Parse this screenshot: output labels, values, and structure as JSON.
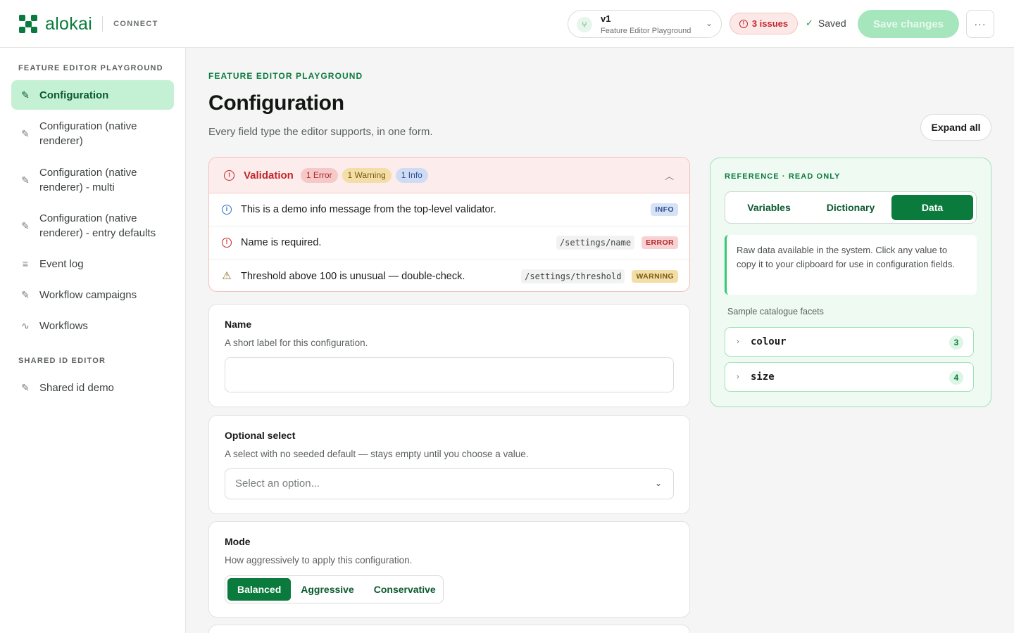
{
  "header": {
    "brand": "alokai",
    "brand_sub": "CONNECT",
    "version_title": "v1",
    "version_subtitle": "Feature Editor Playground",
    "issues": "3 issues",
    "saved": "Saved",
    "save_label": "Save changes",
    "more_label": "···"
  },
  "sidebar": {
    "section1": "FEATURE EDITOR PLAYGROUND",
    "items": [
      {
        "label": "Configuration",
        "icon": "edit-icon"
      },
      {
        "label": "Configuration (native renderer)",
        "icon": "edit-icon"
      },
      {
        "label": "Configuration (native renderer) - multi",
        "icon": "edit-icon"
      },
      {
        "label": "Configuration (native renderer) - entry defaults",
        "icon": "edit-icon"
      },
      {
        "label": "Event log",
        "icon": "list-icon"
      },
      {
        "label": "Workflow campaigns",
        "icon": "edit-icon"
      },
      {
        "label": "Workflows",
        "icon": "activity-icon"
      }
    ],
    "section2": "SHARED ID EDITOR",
    "items2": [
      {
        "label": "Shared id demo",
        "icon": "edit-icon"
      }
    ]
  },
  "main": {
    "eyebrow": "FEATURE EDITOR PLAYGROUND",
    "title": "Configuration",
    "subtitle": "Every field type the editor supports, in one form.",
    "expand_label": "Expand all"
  },
  "validation": {
    "title": "Validation",
    "badges": {
      "error": "1 Error",
      "warning": "1 Warning",
      "info": "1 Info"
    },
    "rows": [
      {
        "message": "This is a demo info message from the top-level validator.",
        "path": "",
        "level": "INFO"
      },
      {
        "message": "Name is required.",
        "path": "/settings/name",
        "level": "ERROR"
      },
      {
        "message": "Threshold above 100 is unusual — double-check.",
        "path": "/settings/threshold",
        "level": "WARNING"
      }
    ]
  },
  "fields": {
    "name": {
      "label": "Name",
      "help": "A short label for this configuration.",
      "value": ""
    },
    "optional_select": {
      "label": "Optional select",
      "help": "A select with no seeded default — stays empty until you choose a value.",
      "placeholder": "Select an option..."
    },
    "mode": {
      "label": "Mode",
      "help": "How aggressively to apply this configuration.",
      "options": [
        "Balanced",
        "Aggressive",
        "Conservative"
      ],
      "selected": "Balanced"
    }
  },
  "reference": {
    "eyebrow": "REFERENCE · READ ONLY",
    "tabs": [
      "Variables",
      "Dictionary",
      "Data"
    ],
    "active_tab": "Data",
    "note": "Raw data available in the system. Click any value to copy it to your clipboard for use in configuration fields.",
    "caption": "Sample catalogue facets",
    "facets": [
      {
        "name": "colour",
        "count": "3"
      },
      {
        "name": "size",
        "count": "4"
      }
    ]
  },
  "colors": {
    "accent": "#0a7b3d",
    "accent_light": "#c4f1d4",
    "error": "#c0272d",
    "warning": "#7a5b0f",
    "info": "#2c4f93"
  }
}
